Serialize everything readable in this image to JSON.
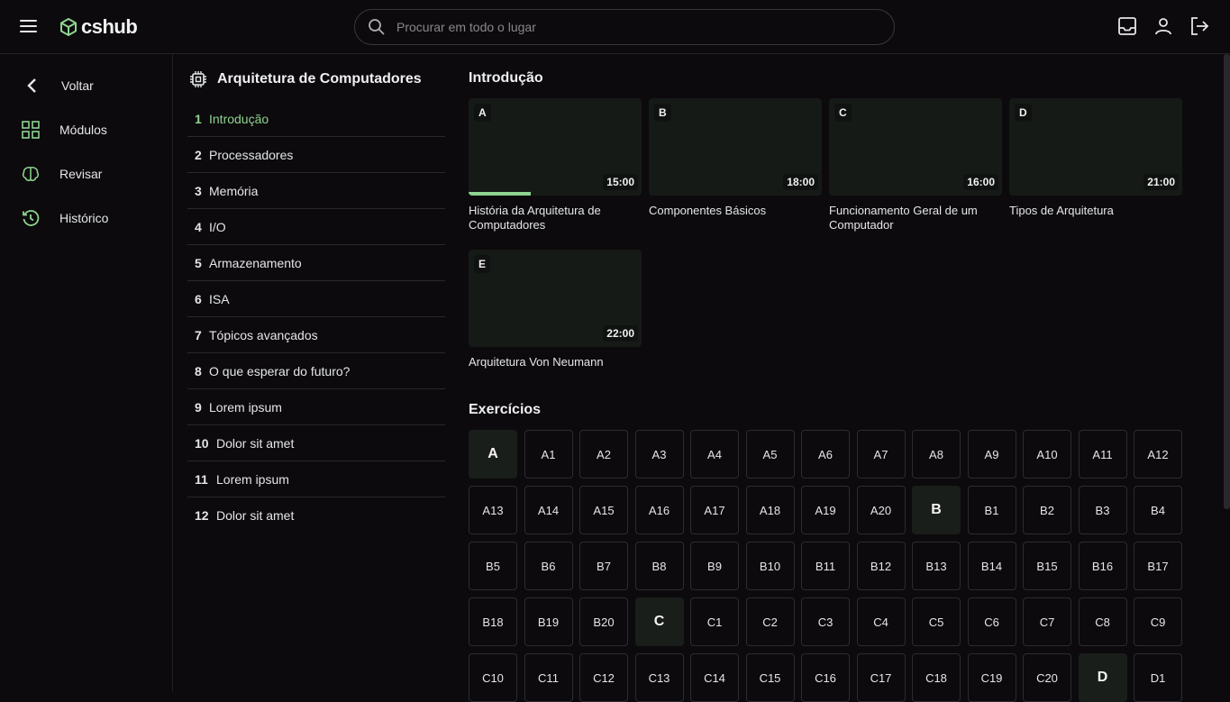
{
  "app": {
    "name": "cshub",
    "accent": "#8fd48f"
  },
  "search": {
    "placeholder": "Procurar em todo o lugar"
  },
  "header_icons": [
    "inbox-icon",
    "user-icon",
    "logout-icon"
  ],
  "sidebar": {
    "items": [
      {
        "label": "Voltar",
        "icon": "chevron-left-icon"
      },
      {
        "label": "Módulos",
        "icon": "grid-icon"
      },
      {
        "label": "Revisar",
        "icon": "brain-icon"
      },
      {
        "label": "Histórico",
        "icon": "history-icon"
      }
    ]
  },
  "course": {
    "title": "Arquitetura de Computadores",
    "icon": "chip-icon",
    "modules": [
      {
        "num": "1",
        "label": "Introdução",
        "active": true
      },
      {
        "num": "2",
        "label": "Processadores"
      },
      {
        "num": "3",
        "label": "Memória"
      },
      {
        "num": "4",
        "label": "I/O"
      },
      {
        "num": "5",
        "label": "Armazenamento"
      },
      {
        "num": "6",
        "label": "ISA"
      },
      {
        "num": "7",
        "label": "Tópicos avançados"
      },
      {
        "num": "8",
        "label": "O que esperar do futuro?"
      },
      {
        "num": "9",
        "label": "Lorem ipsum"
      },
      {
        "num": "10",
        "label": "Dolor sit amet"
      },
      {
        "num": "11",
        "label": "Lorem ipsum"
      },
      {
        "num": "12",
        "label": "Dolor sit amet"
      }
    ]
  },
  "main": {
    "section_title": "Introdução",
    "videos": [
      {
        "letter": "A",
        "duration": "15:00",
        "title": "História da Arquitetura de Computadores",
        "progress": 0.36
      },
      {
        "letter": "B",
        "duration": "18:00",
        "title": "Componentes Básicos"
      },
      {
        "letter": "C",
        "duration": "16:00",
        "title": "Funcionamento Geral de um Computador"
      },
      {
        "letter": "D",
        "duration": "21:00",
        "title": "Tipos de Arquitetura"
      },
      {
        "letter": "E",
        "duration": "22:00",
        "title": "Arquitetura Von Neumann"
      }
    ],
    "exercises_title": "Exercícios",
    "exercises": [
      "A",
      "A1",
      "A2",
      "A3",
      "A4",
      "A5",
      "A6",
      "A7",
      "A8",
      "A9",
      "A10",
      "A11",
      "A12",
      "A13",
      "A14",
      "A15",
      "A16",
      "A17",
      "A18",
      "A19",
      "A20",
      "B",
      "B1",
      "B2",
      "B3",
      "B4",
      "B5",
      "B6",
      "B7",
      "B8",
      "B9",
      "B10",
      "B11",
      "B12",
      "B13",
      "B14",
      "B15",
      "B16",
      "B17",
      "B18",
      "B19",
      "B20",
      "C",
      "C1",
      "C2",
      "C3",
      "C4",
      "C5",
      "C6",
      "C7",
      "C8",
      "C9",
      "C10",
      "C11",
      "C12",
      "C13",
      "C14",
      "C15",
      "C16",
      "C17",
      "C18",
      "C19",
      "C20",
      "D",
      "D1"
    ]
  }
}
